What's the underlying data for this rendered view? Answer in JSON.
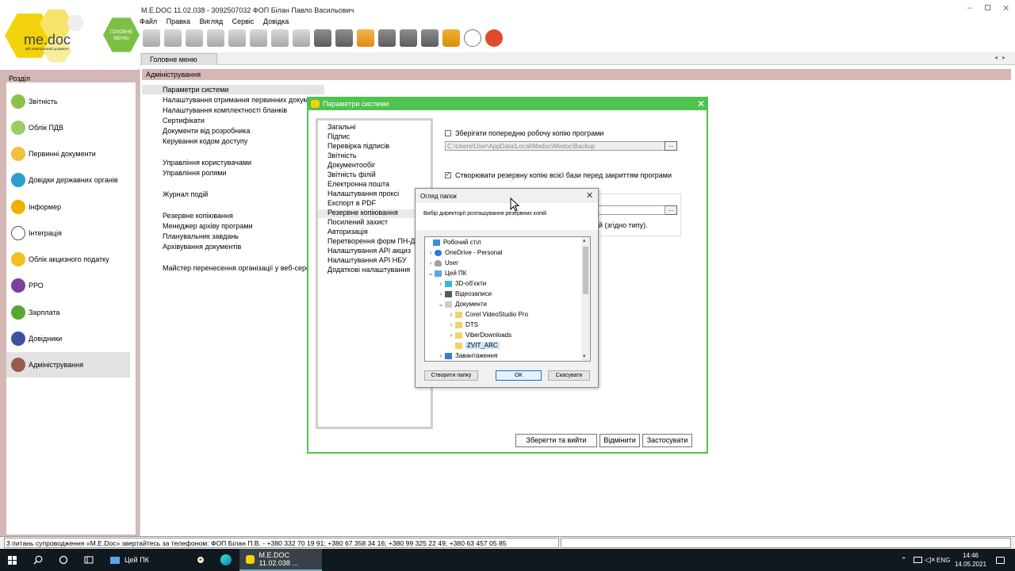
{
  "window": {
    "title": "M.E.DOC 11.02.038 - 3092507032 ФОП Білан Павло Васильович",
    "logo_text": "me.doc",
    "logo_tagline": "мій електронний документ",
    "home_badge": "ГОЛОВНЕ МЕНЮ"
  },
  "menu": [
    "Файл",
    "Правка",
    "Вигляд",
    "Сервіс",
    "Довідка"
  ],
  "toolbar_icons": [
    "new-doc-icon",
    "open-doc-icon",
    "delete-doc-icon",
    "copy-icon",
    "paste-icon",
    "add-icon",
    "edit-icon",
    "remove-icon",
    "import-icon",
    "print-icon",
    "send-icon",
    "receive-icon",
    "sign-icon",
    "check-icon",
    "help-icon",
    "chat-icon",
    "notification-icon"
  ],
  "tab": "Головне меню",
  "sidebar": {
    "title": "Розділ",
    "items": [
      {
        "label": "Звітність",
        "color": "#8bc34a"
      },
      {
        "label": "Облік ПДВ",
        "color": "#9ccc65"
      },
      {
        "label": "Первинні документи",
        "color": "#f0c040"
      },
      {
        "label": "Довідки державних органів",
        "color": "#29a0d0"
      },
      {
        "label": "Інформер",
        "color": "#f0b000"
      },
      {
        "label": "Інтеграція",
        "color": "#ffffff"
      },
      {
        "label": "Облік акцизного податку",
        "color": "#f0c020"
      },
      {
        "label": "РРО",
        "color": "#7b3fa0"
      },
      {
        "label": "Зарплата",
        "color": "#55a830"
      },
      {
        "label": "Довідники",
        "color": "#4050a0"
      },
      {
        "label": "Адміністрування",
        "color": "#9a5a50"
      }
    ]
  },
  "content": {
    "header": "Адміністрування",
    "groups": [
      [
        "Параметри системи",
        "Налаштування отримання первинних документів",
        "Налаштування комплектності бланків",
        "Сертифікати",
        "Документи від розробника",
        "Керування кодом доступу"
      ],
      [
        "Управління користувачами",
        "Управління ролями"
      ],
      [
        "Журнал подій"
      ],
      [
        "Резервне копіювання",
        "Менеджер архіву програми",
        "Планувальник завдань",
        "Архівування документів"
      ],
      [
        "Майстер перенесення організації у веб-середовище"
      ]
    ]
  },
  "params_dialog": {
    "title": "Параметри системи",
    "list": [
      "Загальні",
      "Підпис",
      "Перевірка підписів",
      "Звітність",
      "Документообіг",
      "Звітність філій",
      "Електронна пошта",
      "Налаштування проксі",
      "Експорт в PDF",
      "Резервне копіювання",
      "Посилений захист",
      "Авторизація",
      "Перетворення форм ПН-ДП",
      "Налаштування API акциз",
      "Налаштування API НБУ",
      "Додаткові налаштування"
    ],
    "selected_index": 9,
    "option1_label": "Зберігати попередню робочу копію програми",
    "option1_checked": false,
    "option1_path": "C:\\Users\\User\\AppData\\Local\\Medoc\\Medoc\\Backup",
    "option2_label": "Створювати резервну копію всієї бази перед закриттям програми",
    "option2_checked": true,
    "partial_text": "й (згідно типу).",
    "dots": "...",
    "btn_save_exit": "Зберегти та вийти",
    "btn_cancel": "Відмінити",
    "btn_apply": "Застосувати"
  },
  "browse_dialog": {
    "title": "Огляд папок",
    "description": "Вибір директорії розташування резервних копій",
    "tree": [
      {
        "label": "Робочий стіл",
        "level": 0,
        "arrow": "",
        "icon": "desktop-icon"
      },
      {
        "label": "OneDrive - Personal",
        "level": 1,
        "arrow": "›",
        "icon": "cloud-icon"
      },
      {
        "label": "User",
        "level": 1,
        "arrow": "›",
        "icon": "user-icon"
      },
      {
        "label": "Цей ПК",
        "level": 1,
        "arrow": "⌄",
        "icon": "pc-icon"
      },
      {
        "label": "3D-об'єкти",
        "level": 2,
        "arrow": "›",
        "icon": "cube-icon"
      },
      {
        "label": "Відеозаписи",
        "level": 2,
        "arrow": "›",
        "icon": "video-icon"
      },
      {
        "label": "Документи",
        "level": 2,
        "arrow": "⌄",
        "icon": "documents-icon"
      },
      {
        "label": "Corel VideoStudio Pro",
        "level": 3,
        "arrow": "›",
        "icon": "folder-icon"
      },
      {
        "label": "DTS",
        "level": 3,
        "arrow": "›",
        "icon": "folder-icon"
      },
      {
        "label": "ViberDownloads",
        "level": 3,
        "arrow": "›",
        "icon": "folder-icon"
      },
      {
        "label": "ZVIT_ARC",
        "level": 3,
        "arrow": "",
        "icon": "folder-icon",
        "selected": true
      },
      {
        "label": "Завантаження",
        "level": 2,
        "arrow": "›",
        "icon": "download-icon"
      }
    ],
    "btn_new_folder": "Створити папку",
    "btn_ok": "OK",
    "btn_cancel": "Скасувати"
  },
  "status": {
    "text": "3 питань супроводження «M.E.Doc» звертайтесь за телефоном: ФОП Білан П.В. - +380 332 70 19 91; +380 67 358 34 16; +380 99 325 22 49; +380 63 457 05 85"
  },
  "taskbar": {
    "explorer_label": "Цей ПК",
    "medoc_label": "M.E.DOC 11.02.038 ...",
    "language": "ENG",
    "time": "14:46",
    "date": "14.05.2021"
  }
}
